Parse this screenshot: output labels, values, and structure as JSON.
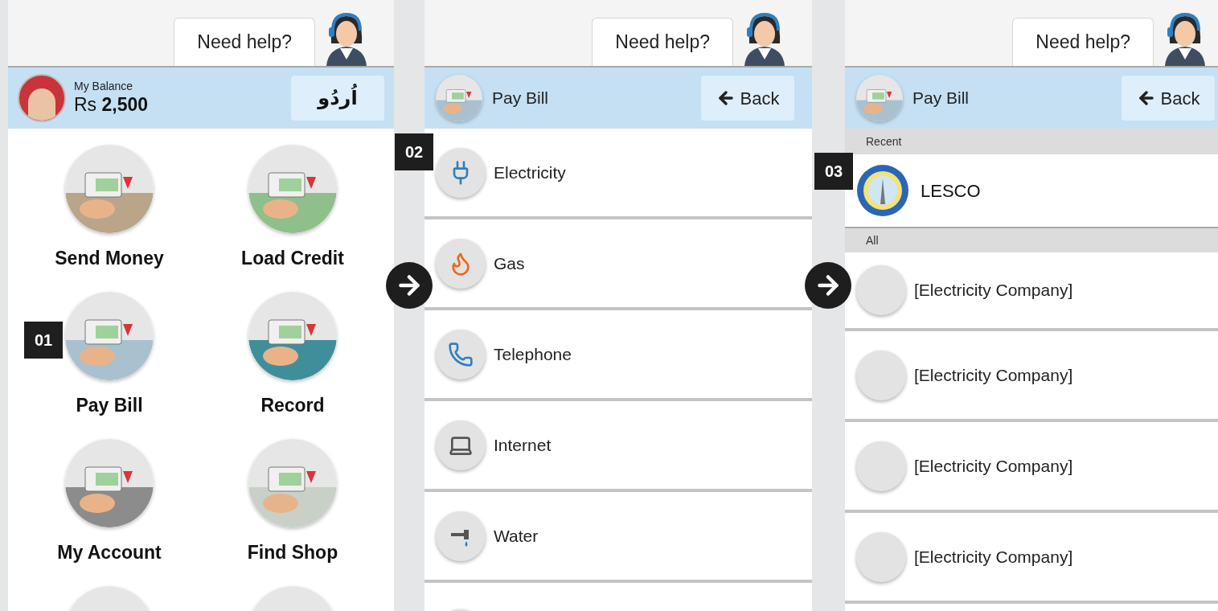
{
  "help": [
    {
      "label": "Need help?"
    },
    {
      "label": "Need help?"
    },
    {
      "label": "Need help?"
    }
  ],
  "home": {
    "balance_label": "My Balance",
    "balance": "Rs **2,500**",
    "language_button": "اُردُو",
    "tiles": [
      {
        "label": "Send Money"
      },
      {
        "label": "Load Credit"
      },
      {
        "label": "Pay Bill"
      },
      {
        "label": "Record"
      },
      {
        "label": "My Account"
      },
      {
        "label": "Find Shop"
      }
    ]
  },
  "categories": {
    "title": "Pay Bill",
    "back_button": "Back",
    "items": [
      {
        "label": "Electricity"
      },
      {
        "label": "Gas"
      },
      {
        "label": "Telephone"
      },
      {
        "label": "Internet"
      },
      {
        "label": "Water"
      }
    ]
  },
  "companies": {
    "title": "Pay Bill",
    "back_button": "Back",
    "recent_header": "Recent",
    "recent": [
      {
        "label": "LESCO"
      }
    ],
    "all_header": "All",
    "items": [
      {
        "label": "[Electricity Company]"
      },
      {
        "label": "[Electricity Company]"
      },
      {
        "label": "[Electricity Company]"
      },
      {
        "label": "[Electricity Company]"
      }
    ]
  },
  "steps": [
    {
      "label": "01"
    },
    {
      "label": "02"
    },
    {
      "label": "03"
    }
  ]
}
